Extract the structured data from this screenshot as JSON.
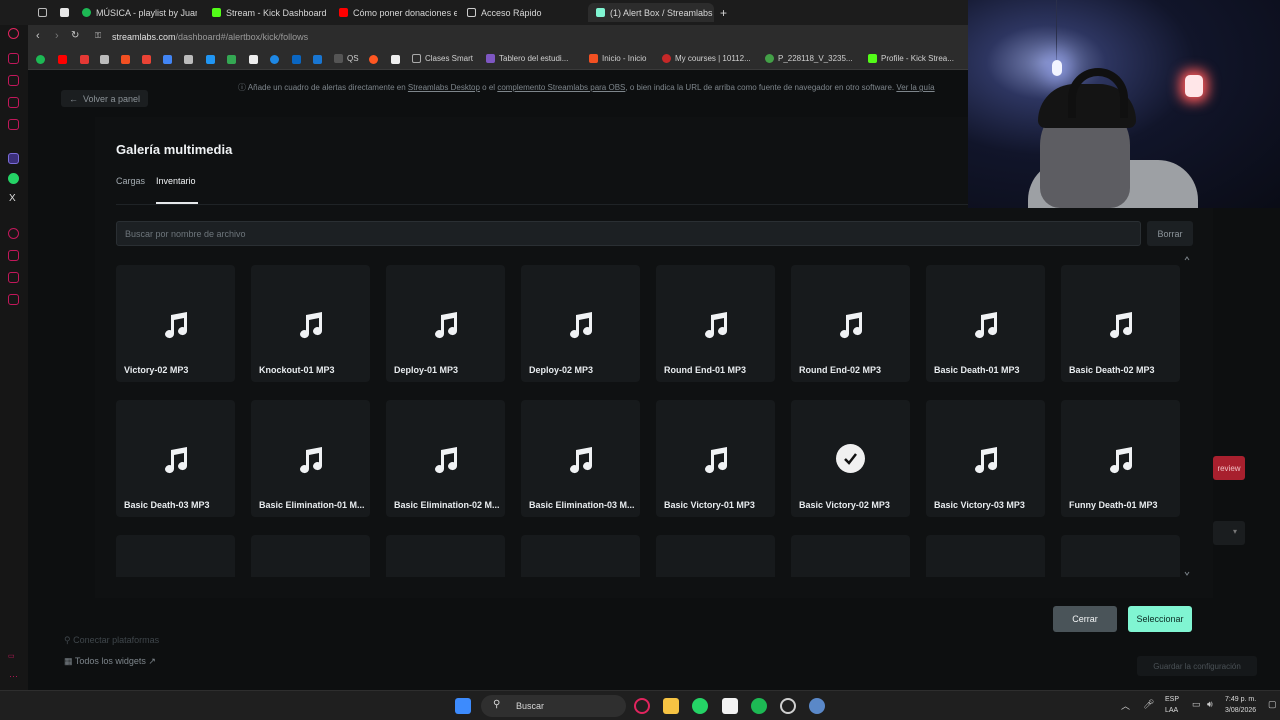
{
  "browser": {
    "tabs": [
      {
        "label": "MÚSICA - playlist by Juan I",
        "color": "#1db954"
      },
      {
        "label": "Stream - Kick Dashboard",
        "color": "#53fc18"
      },
      {
        "label": "Cómo poner donaciones e",
        "color": "#ff0000"
      },
      {
        "label": "Acceso Rápido",
        "color": "#d0d0d0"
      },
      {
        "label": "(1) Alert Box / Streamlabs",
        "color": "#80f5d2"
      }
    ],
    "url_domain": "streamlabs.com",
    "url_path": "/dashboard#/alertbox/kick/follows",
    "bookmarks": [
      "QS",
      "Clases Smart",
      "Tablero del estudi...",
      "Inicio - Inicio",
      "My courses | 10112...",
      "P_228118_V_3235...",
      "Profile - Kick Strea..."
    ]
  },
  "page": {
    "back_label": "Volver a panel",
    "notice": "Añade un cuadro de alertas directamente en",
    "notice_link1": "Streamlabs Desktop",
    "notice_mid": "o el",
    "notice_link2": "complemento Streamlabs para OBS",
    "notice_end": ", o bien indica la URL de arriba como fuente de navegador en otro software.",
    "notice_link3": "Ver la guía",
    "bottom_items": [
      "Conectar plataformas",
      "Todos los widgets"
    ],
    "save_label": "Guardar la configuración",
    "preview_label": "review"
  },
  "modal": {
    "title": "Galería multimedia",
    "tabs": [
      "Cargas",
      "Inventario"
    ],
    "active_tab": "Inventario",
    "search_placeholder": "Buscar por nombre de archivo",
    "clear_label": "Borrar",
    "files": [
      {
        "name": "Victory-02 MP3",
        "selected": false
      },
      {
        "name": "Knockout-01 MP3",
        "selected": false
      },
      {
        "name": "Deploy-01 MP3",
        "selected": false
      },
      {
        "name": "Deploy-02 MP3",
        "selected": false
      },
      {
        "name": "Round End-01 MP3",
        "selected": false
      },
      {
        "name": "Round End-02 MP3",
        "selected": false
      },
      {
        "name": "Basic Death-01 MP3",
        "selected": false
      },
      {
        "name": "Basic Death-02 MP3",
        "selected": false
      },
      {
        "name": "Basic Death-03 MP3",
        "selected": false
      },
      {
        "name": "Basic Elimination-01 M...",
        "selected": false
      },
      {
        "name": "Basic Elimination-02 M...",
        "selected": false
      },
      {
        "name": "Basic Elimination-03 M...",
        "selected": false
      },
      {
        "name": "Basic Victory-01 MP3",
        "selected": false
      },
      {
        "name": "Basic Victory-02 MP3",
        "selected": true
      },
      {
        "name": "Basic Victory-03 MP3",
        "selected": false
      },
      {
        "name": "Funny Death-01 MP3",
        "selected": false
      },
      {
        "name": "",
        "selected": false
      },
      {
        "name": "",
        "selected": false
      },
      {
        "name": "",
        "selected": false
      },
      {
        "name": "",
        "selected": false
      },
      {
        "name": "",
        "selected": false
      },
      {
        "name": "",
        "selected": false
      },
      {
        "name": "",
        "selected": false
      },
      {
        "name": "",
        "selected": false
      }
    ],
    "close_label": "Cerrar",
    "select_label": "Seleccionar"
  },
  "taskbar": {
    "search_label": "Buscar",
    "lang_line1": "ESP",
    "lang_line2": "LAA",
    "time": "7:49 p. m.",
    "date": "3/08/2026"
  },
  "colors": {
    "accent": "#80f5d2",
    "card_bg": "#171a1c",
    "modal_bg": "#0f1112"
  }
}
